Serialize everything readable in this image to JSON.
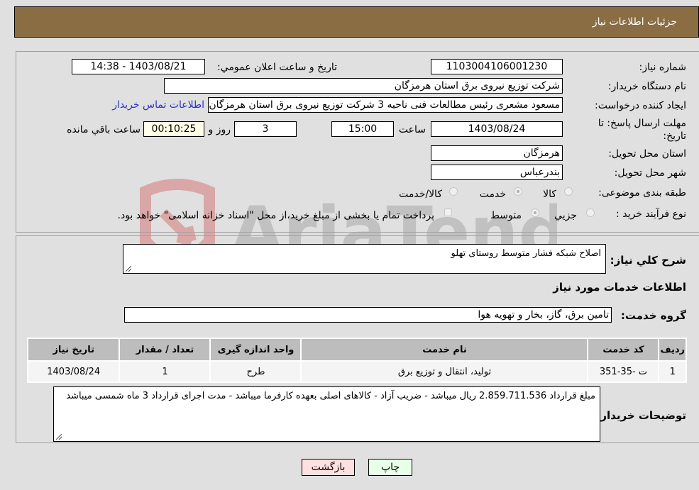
{
  "header": {
    "title": "جزئیات اطلاعات نیاز"
  },
  "form": {
    "need_number_label": "شماره نیاز:",
    "need_number": "1103004106001230",
    "announce_label": "تاریخ و ساعت اعلان عمومي:",
    "announce_value": "1403/08/21 - 14:38",
    "buyer_org_label": "نام دستگاه خریدار:",
    "buyer_org": "شرکت توزیع نیروی برق استان هرمزگان",
    "creator_label": "ایجاد کننده درخواست:",
    "creator": "مسعود مشعری رئیس مطالعات فنی ناحیه 3 شرکت توزیع نیروی برق استان هرمزگان",
    "contact_link": "اطلاعات تماس خریدار",
    "deadline_label": "مهلت ارسال پاسخ: تا تاریخ:",
    "deadline_date": "1403/08/24",
    "time_label": "ساعت",
    "deadline_time": "15:00",
    "days_value": "3",
    "days_label": "روز و",
    "remaining_time": "00:10:25",
    "remaining_label": "ساعت باقي مانده",
    "province_label": "استان محل تحویل:",
    "province": "هرمزگان",
    "city_label": "شهر محل تحویل:",
    "city": "بندرعباس",
    "category_label": "طبقه بندی موضوعی:",
    "category_options": [
      "کالا",
      "خدمت",
      "کالا/خدمت"
    ],
    "category_selected": "خدمت",
    "process_label": "نوع فرآیند خرید :",
    "process_options": [
      "جزيي",
      "متوسط"
    ],
    "process_selected": "متوسط",
    "treasury_note": "پرداخت تمام یا بخشی از مبلغ خرید،از محل \"اسناد خزانه اسلامی\" خواهد بود."
  },
  "details": {
    "summary_label": "شرح کلي نیاز:",
    "summary": "اصلاح شبکه فشار متوسط روستای تهلو",
    "services_heading": "اطلاعات خدمات مورد نیاز",
    "service_group_label": "گروه خدمت:",
    "service_group": "تامین برق، گاز، بخار و تهویه هوا",
    "table": {
      "columns": [
        "ردیف",
        "کد خدمت",
        "نام خدمت",
        "واحد اندازه گیری",
        "تعداد / مقدار",
        "تاریخ نیاز"
      ],
      "rows": [
        [
          "1",
          "ت -35-351",
          "تولید، انتقال و توزیع برق",
          "طرح",
          "1",
          "1403/08/24"
        ]
      ]
    },
    "buyer_notes_label": "توضیحات خریدار:",
    "buyer_notes": "مبلغ قرارداد 2.859.711.536 ریال میباشد - ضریب آزاد - کالاهای اصلی بعهده کارفرما میباشد - مدت اجرای قرارداد 3 ماه شمسی میباشد"
  },
  "buttons": {
    "print": "چاپ",
    "back": "بازگشت"
  },
  "colors": {
    "header_bg": "#8b6d43",
    "back_bg": "#ffe0e0",
    "print_bg": "#e8ffe8",
    "link": "#2f2fcf"
  },
  "watermark": {
    "text": "AriaTender.neT"
  }
}
